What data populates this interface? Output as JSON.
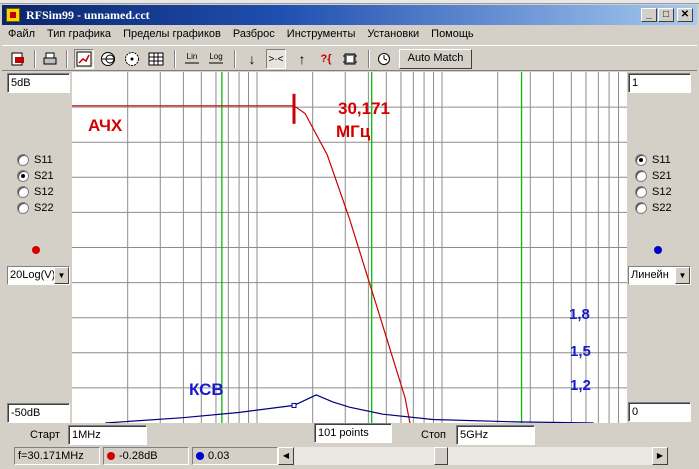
{
  "window": {
    "title": "RFSim99 - unnamed.cct",
    "btn_minimize": "_",
    "btn_maximize": "□",
    "btn_close": "✕"
  },
  "menu": {
    "items": [
      "Файл",
      "Тип графика",
      "Пределы графиков",
      "Разброс",
      "Инструменты",
      "Установки",
      "Помощь"
    ]
  },
  "toolbar": {
    "lin_label": "Lin",
    "log_label": "Log",
    "arrow_down": "↓",
    "arrow_in": ">·<",
    "arrow_up": "↑",
    "help_marker": "?{",
    "auto_match_label": "Auto Match"
  },
  "left_panel": {
    "top_value": "5dB",
    "bottom_value": "-50dB",
    "params": [
      "S11",
      "S21",
      "S12",
      "S22"
    ],
    "selected": "S21",
    "marker_color": "#d40000",
    "scale_value": "20Log(V)"
  },
  "right_panel": {
    "top_value": "1",
    "bottom_value": "0",
    "params": [
      "S11",
      "S21",
      "S12",
      "S22"
    ],
    "selected": "S11",
    "marker_color": "#0000cc",
    "scale_value": "Линейн"
  },
  "annotations": {
    "ach_label": "АЧХ",
    "freq_value": "30,171",
    "freq_unit": "МГц",
    "ksv_label": "КСВ",
    "ksv_18": "1,8",
    "ksv_15": "1,5",
    "ksv_12": "1,2"
  },
  "bottom": {
    "start_label": "Старт",
    "start_value": "1MHz",
    "points_value": "101 points",
    "stop_label": "Стоп",
    "stop_value": "5GHz"
  },
  "status": {
    "freq": "f=30.171MHz",
    "s21_value": "-0.28dB",
    "s11_value": "0.03"
  },
  "chart_data": {
    "type": "line",
    "series": [
      {
        "name": "АЧХ",
        "axis": "left",
        "color": "#cc0000",
        "x": [
          0.0,
          0.2,
          0.3,
          0.4,
          0.42,
          0.46,
          0.5,
          0.55,
          0.6,
          0.62
        ],
        "y": [
          -0.3,
          -0.3,
          -0.3,
          -0.3,
          -1.5,
          -8,
          -18,
          -32,
          -46,
          -55
        ]
      },
      {
        "name": "КСВ",
        "axis": "right",
        "color": "#000080",
        "x": [
          0.06,
          0.2,
          0.3,
          0.4,
          0.44,
          0.47,
          0.5,
          0.56,
          0.65,
          0.8,
          0.94
        ],
        "y": [
          0.0,
          0.015,
          0.03,
          0.05,
          0.08,
          0.06,
          0.045,
          0.025,
          0.01,
          0.003,
          0.0
        ]
      }
    ],
    "x_range": [
      0,
      1
    ],
    "left_ylim": [
      -50,
      5
    ],
    "right_ylim": [
      0,
      1
    ],
    "green_verticals": [
      0.27,
      0.54,
      0.81
    ],
    "marker_x": 0.4,
    "grid": true
  }
}
